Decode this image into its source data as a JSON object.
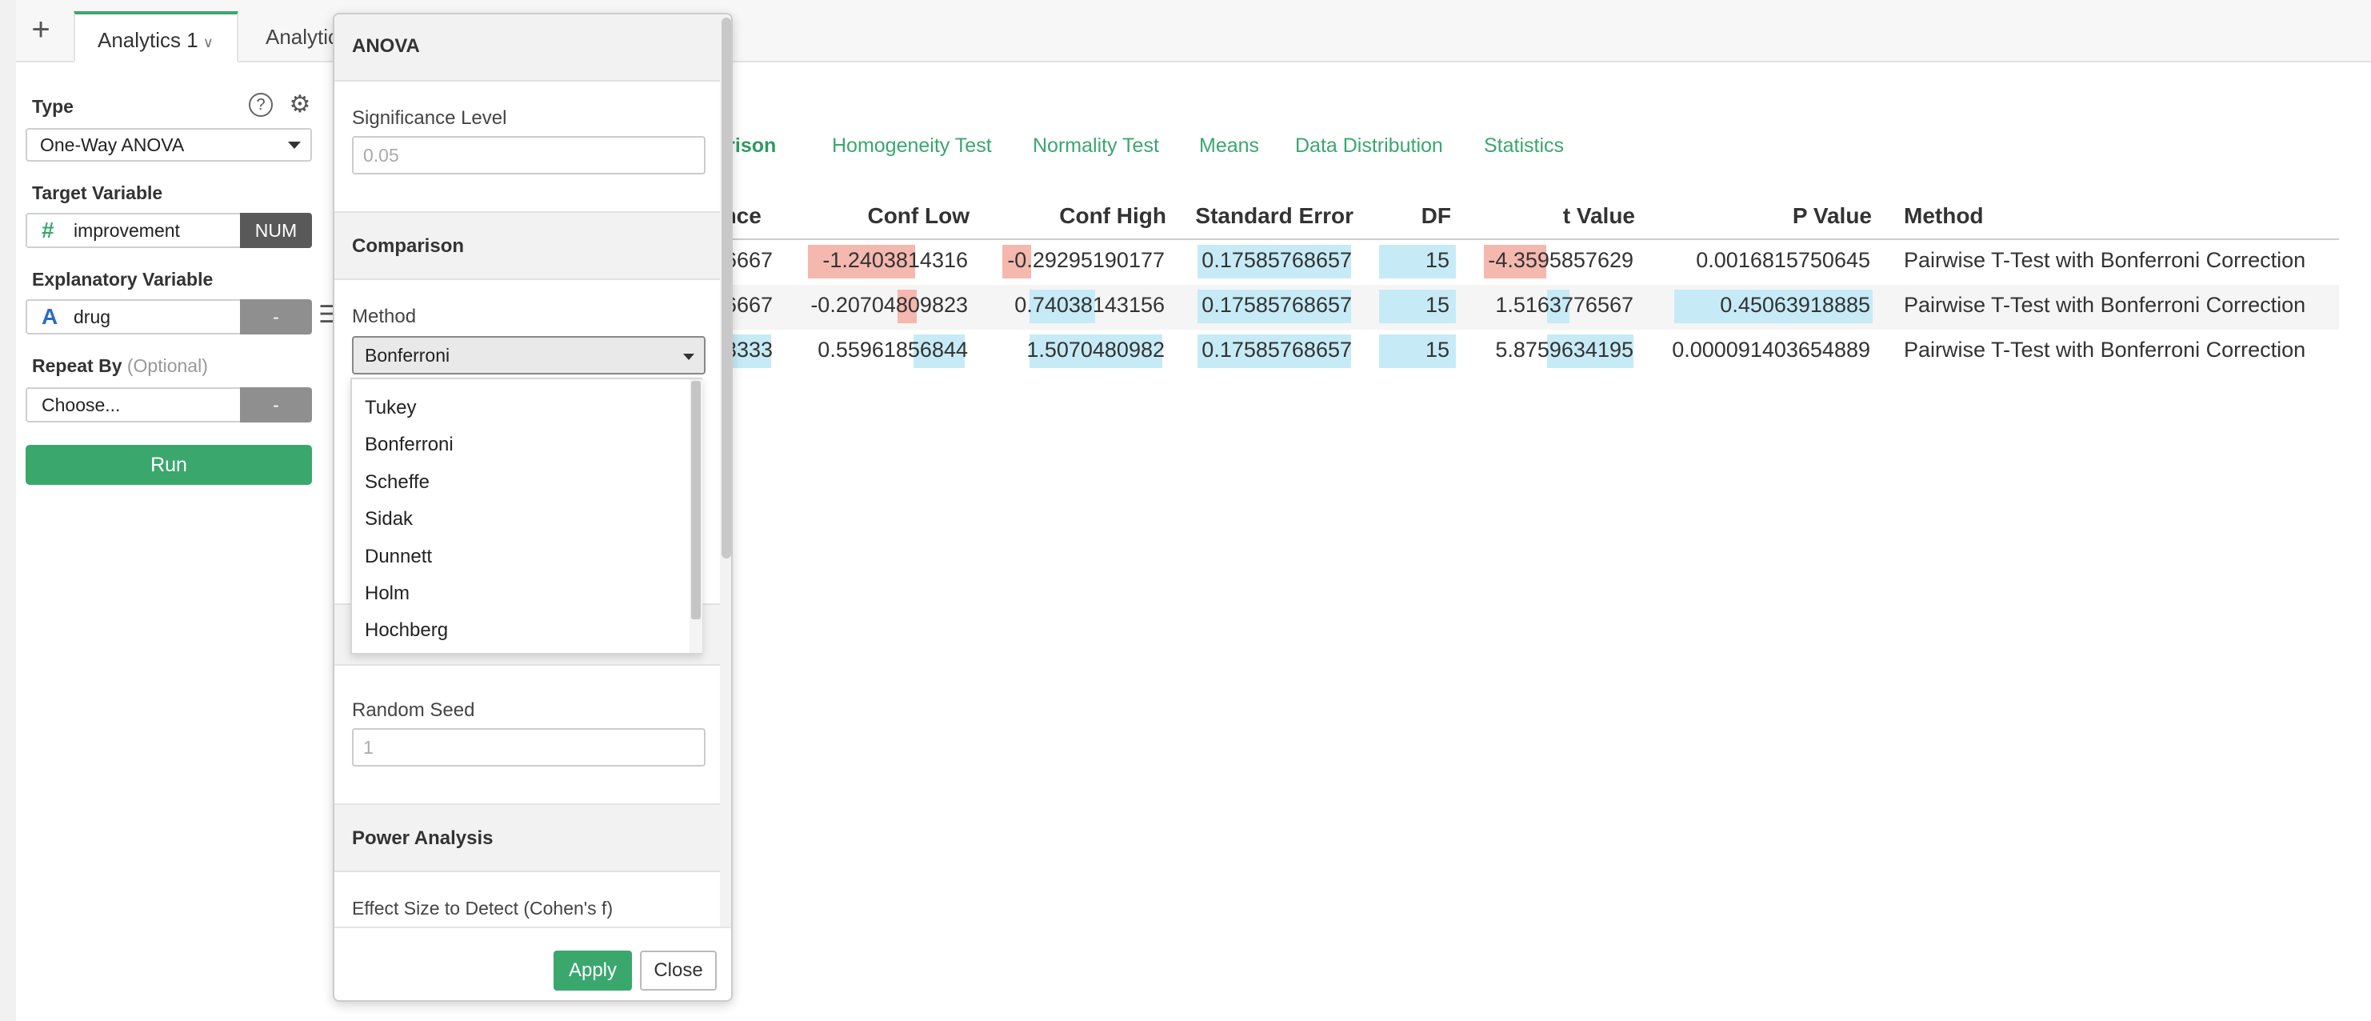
{
  "tabbar": {
    "add_label": "+",
    "tabs": [
      {
        "label": "Analytics 1",
        "chevron": "chevron-down-icon"
      },
      {
        "label": "Analytic"
      }
    ]
  },
  "left_panel": {
    "type_label": "Type",
    "type_value": "One-Way ANOVA",
    "target_label": "Target Variable",
    "target_icon": "#",
    "target_value": "improvement",
    "target_tag": "NUM",
    "explanatory_label": "Explanatory Variable",
    "explanatory_icon": "A",
    "explanatory_value": "drug",
    "explanatory_tag": "-",
    "repeat_label": "Repeat By",
    "repeat_optional": "(Optional)",
    "repeat_value": "Choose...",
    "repeat_tag": "-",
    "run_label": "Run"
  },
  "result_tabs": [
    "parison",
    "Homogeneity Test",
    "Normality Test",
    "Means",
    "Data Distribution",
    "Statistics"
  ],
  "table": {
    "headers": [
      "ence",
      "Conf Low",
      "Conf High",
      "Standard Error",
      "DF",
      "t Value",
      "P Value",
      "Method"
    ],
    "rows": [
      [
        "6667",
        "-1.2403814316",
        "-0.29295190177",
        "0.17585768657",
        "15",
        "-4.3595857629",
        "0.0016815750645",
        "Pairwise T-Test with Bonferroni Correction"
      ],
      [
        "6667",
        "-0.20704809823",
        "0.74038143156",
        "0.17585768657",
        "15",
        "1.5163776567",
        "0.45063918885",
        "Pairwise T-Test with Bonferroni Correction"
      ],
      [
        "3333",
        "0.55961856844",
        "1.5070480982",
        "0.17585768657",
        "15",
        "5.8759634195",
        "0.000091403654889",
        "Pairwise T-Test with Bonferroni Correction"
      ]
    ]
  },
  "anova_panel": {
    "title": "ANOVA",
    "significance_label": "Significance Level",
    "significance_placeholder": "0.05",
    "comparison_title": "Comparison",
    "method_label": "Method",
    "method_value": "Bonferroni",
    "method_options": [
      "Tukey",
      "Bonferroni",
      "Scheffe",
      "Sidak",
      "Dunnett",
      "Holm",
      "Hochberg"
    ],
    "random_seed_label": "Random Seed",
    "random_seed_placeholder": "1",
    "power_title": "Power Analysis",
    "effect_label": "Effect Size to Detect (Cohen's f)",
    "apply_label": "Apply",
    "close_label": "Close"
  },
  "colors": {
    "accent": "#3aa76d",
    "highlight_negative": "#f4b8ae",
    "highlight_positive": "#c6ebf6"
  }
}
